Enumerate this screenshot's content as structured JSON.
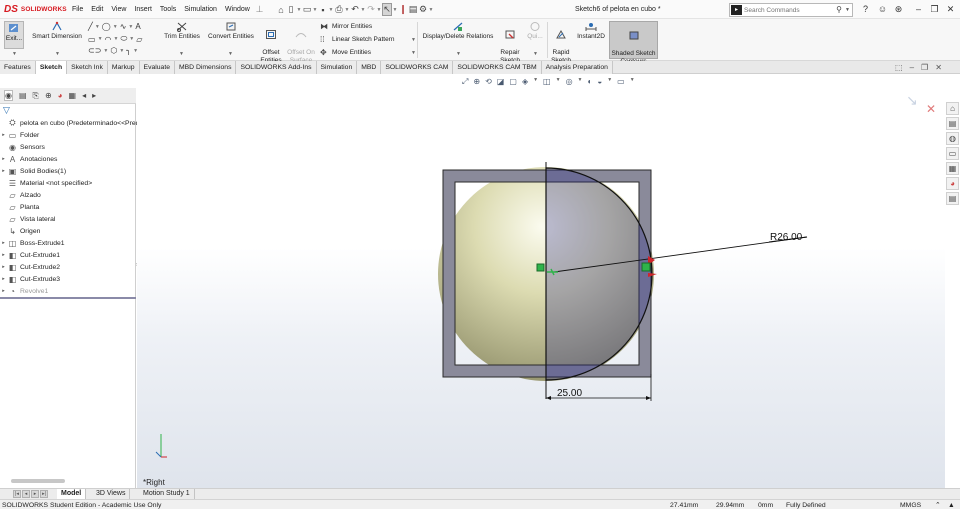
{
  "app": {
    "logo_mark": "DS",
    "brand": "SOLIDWORKS",
    "document_title": "Sketch6 of pelota en cubo *"
  },
  "menus": [
    "File",
    "Edit",
    "View",
    "Insert",
    "Tools",
    "Simulation",
    "Window"
  ],
  "search": {
    "placeholder": "Search Commands"
  },
  "commands": {
    "exit": "Exit...",
    "smart_dimension": "Smart Dimension",
    "trim_entities": "Trim Entities",
    "convert_entities": "Convert Entities",
    "offset_entities": "Offset\nEntities",
    "offset_on_surface": "Offset On\nSurface",
    "mirror_entities": "Mirror Entities",
    "linear_sketch_pattern": "Linear Sketch Pattern",
    "move_entities": "Move Entities",
    "display_delete_relations": "Display/Delete Relations",
    "repair_sketch": "Repair\nSketch",
    "quick_snaps": "Qui...",
    "rapid_sketch": "Rapid\nSketch",
    "instant2d": "Instant2D",
    "shaded_sketch_contours": "Shaded Sketch\nContours"
  },
  "tabs": [
    "Features",
    "Sketch",
    "Sketch Ink",
    "Markup",
    "Evaluate",
    "MBD Dimensions",
    "SOLIDWORKS Add-Ins",
    "Simulation",
    "MBD",
    "SOLIDWORKS CAM",
    "SOLIDWORKS CAM TBM",
    "Analysis Preparation"
  ],
  "active_tab": "Sketch",
  "feature_tree": [
    {
      "label": "pelota en cubo  (Predeterminado<<Pred",
      "icon": "part-icon",
      "expander": false,
      "grey": false
    },
    {
      "label": "Folder",
      "icon": "folder-icon",
      "expander": true,
      "grey": false
    },
    {
      "label": "Sensors",
      "icon": "sensor-icon",
      "expander": false,
      "grey": false
    },
    {
      "label": "Anotaciones",
      "icon": "annotation-icon",
      "expander": true,
      "grey": false
    },
    {
      "label": "Solid Bodies(1)",
      "icon": "solid-bodies-icon",
      "expander": true,
      "grey": false
    },
    {
      "label": "Material <not specified>",
      "icon": "material-icon",
      "expander": false,
      "grey": false
    },
    {
      "label": "Alzado",
      "icon": "plane-icon",
      "expander": false,
      "grey": false
    },
    {
      "label": "Planta",
      "icon": "plane-icon",
      "expander": false,
      "grey": false
    },
    {
      "label": "Vista lateral",
      "icon": "plane-icon",
      "expander": false,
      "grey": false
    },
    {
      "label": "Origen",
      "icon": "origin-icon",
      "expander": false,
      "grey": false
    },
    {
      "label": "Boss-Extrude1",
      "icon": "extrude-icon",
      "expander": true,
      "grey": false
    },
    {
      "label": "Cut-Extrude1",
      "icon": "cut-extrude-icon",
      "expander": true,
      "grey": false
    },
    {
      "label": "Cut-Extrude2",
      "icon": "cut-extrude-icon",
      "expander": true,
      "grey": false
    },
    {
      "label": "Cut-Extrude3",
      "icon": "cut-extrude-icon",
      "expander": true,
      "grey": false
    },
    {
      "label": "Revolve1",
      "icon": "revolve-icon",
      "expander": true,
      "grey": true
    }
  ],
  "sketch": {
    "radius_label": "R26.00",
    "width_label": "25.00",
    "view_label": "*Right"
  },
  "bottom_tabs": [
    "Model",
    "3D Views",
    "Motion Study 1"
  ],
  "active_bottom_tab": "Model",
  "status": {
    "edition": "SOLIDWORKS Student Edition - Academic Use Only",
    "x": "27.41mm",
    "y": "29.94mm",
    "z": "0mm",
    "state": "Fully Defined",
    "units": "MMGS"
  },
  "colors": {
    "accent_red": "#d71920",
    "sphere": "#e3e1b8",
    "frame": "#8a8a9a",
    "sketch_green": "#2fb34a"
  }
}
